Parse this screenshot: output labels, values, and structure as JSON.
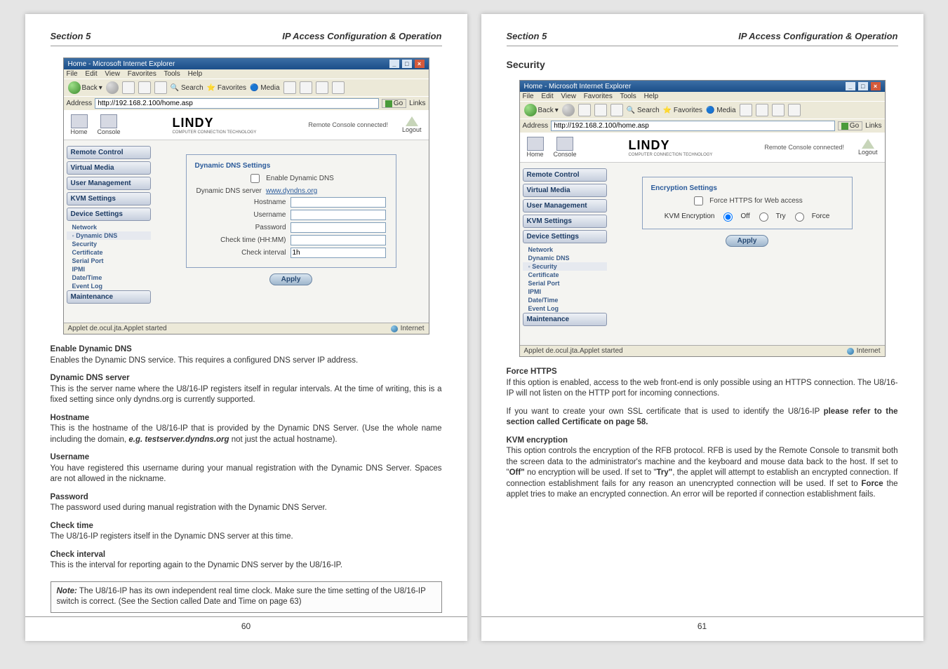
{
  "left": {
    "header": {
      "section": "Section 5",
      "title": "IP Access Configuration & Operation"
    },
    "pageNumber": "60",
    "ie": {
      "title": "Home - Microsoft Internet Explorer",
      "menus": [
        "File",
        "Edit",
        "View",
        "Favorites",
        "Tools",
        "Help"
      ],
      "toolbar": {
        "back": "Back",
        "search": "Search",
        "favorites": "Favorites",
        "media": "Media"
      },
      "address": {
        "label": "Address",
        "value": "http://192.168.2.100/home.asp",
        "go": "Go",
        "links": "Links"
      },
      "status": {
        "left": "Applet de.ocul.jta.Applet started",
        "right": "Internet"
      }
    },
    "app": {
      "top": {
        "home": "Home",
        "console": "Console",
        "logo": "LINDY",
        "logoSub": "COMPUTER CONNECTION TECHNOLOGY",
        "status": "Remote Console connected!",
        "logout": "Logout"
      },
      "sidebar": {
        "items": [
          "Remote Control",
          "Virtual Media",
          "User Management",
          "KVM Settings",
          "Device Settings"
        ],
        "subs": [
          "Network",
          "Dynamic DNS",
          "Security",
          "Certificate",
          "Serial Port",
          "IPMI",
          "Date/Time",
          "Event Log"
        ],
        "activeSub": "Dynamic DNS",
        "last": "Maintenance"
      },
      "form": {
        "legend": "Dynamic DNS Settings",
        "enable": "Enable Dynamic DNS",
        "serverLabel": "Dynamic DNS server",
        "serverValue": "www.dyndns.org",
        "hostname": "Hostname",
        "username": "Username",
        "password": "Password",
        "checkTime": "Check time (HH:MM)",
        "checkInterval": "Check interval",
        "intervalValue": "1h",
        "apply": "Apply"
      }
    },
    "body": {
      "t1": "Enable Dynamic DNS",
      "p1": "Enables the Dynamic DNS service. This requires a configured DNS server IP address.",
      "t2": "Dynamic DNS server",
      "p2": "This is the server name where the U8/16-IP registers itself in regular intervals. At the time of writing, this is a fixed setting since only dyndns.org is currently supported.",
      "t3": "Hostname",
      "p3a": "This is the hostname of the U8/16-IP that is provided by the Dynamic DNS Server. (Use the whole name including the domain, ",
      "p3b": "e.g. testserver.dyndns.org",
      "p3c": " not just the actual hostname).",
      "t4": "Username",
      "p4": "You have registered this username during your manual registration with the Dynamic DNS Server. Spaces are not allowed in the nickname.",
      "t5": "Password",
      "p5": "The password used during manual registration with the Dynamic DNS Server.",
      "t6": "Check time",
      "p6": "The U8/16-IP registers itself in the Dynamic DNS server at this time.",
      "t7": "Check interval",
      "p7": "This is the interval for reporting again to the Dynamic DNS server by the U8/16-IP.",
      "note": {
        "label": "Note:",
        "a": " The U8/16-IP has its own independent real time clock. Make sure the time setting of the U8/16-IP switch is correct. ",
        "b": "(See the Section called Date and Time on page 63)"
      }
    }
  },
  "right": {
    "header": {
      "section": "Section 5",
      "title": "IP Access Configuration & Operation"
    },
    "pageNumber": "61",
    "section": "Security",
    "ie": {
      "title": "Home - Microsoft Internet Explorer",
      "menus": [
        "File",
        "Edit",
        "View",
        "Favorites",
        "Tools",
        "Help"
      ],
      "toolbar": {
        "back": "Back",
        "search": "Search",
        "favorites": "Favorites",
        "media": "Media"
      },
      "address": {
        "label": "Address",
        "value": "http://192.168.2.100/home.asp",
        "go": "Go",
        "links": "Links"
      },
      "status": {
        "left": "Applet de.ocul.jta.Applet started",
        "right": "Internet"
      }
    },
    "app": {
      "top": {
        "home": "Home",
        "console": "Console",
        "logo": "LINDY",
        "logoSub": "COMPUTER CONNECTION TECHNOLOGY",
        "status": "Remote Console connected!",
        "logout": "Logout"
      },
      "sidebar": {
        "items": [
          "Remote Control",
          "Virtual Media",
          "User Management",
          "KVM Settings",
          "Device Settings"
        ],
        "subs": [
          "Network",
          "Dynamic DNS",
          "Security",
          "Certificate",
          "Serial Port",
          "IPMI",
          "Date/Time",
          "Event Log"
        ],
        "activeSub": "Security",
        "last": "Maintenance"
      },
      "form": {
        "legend": "Encryption Settings",
        "forceHttps": "Force HTTPS for Web access",
        "kvmEnc": "KVM Encryption",
        "off": "Off",
        "try": "Try",
        "force": "Force",
        "apply": "Apply"
      }
    },
    "body": {
      "t1": "Force HTTPS",
      "p1": "If this option is enabled, access to the web front-end is only possible using an HTTPS connection. The U8/16-IP will not listen on the HTTP port for incoming connections.",
      "p2a": "If you want to create your own SSL certificate that is used to identify the U8/16-IP ",
      "p2b": "please refer to the section called Certificate on page 58.",
      "t2": "KVM encryption",
      "p3a": "This option controls the encryption of the RFB protocol. RFB is used by the Remote Console to transmit both the screen data to the administrator's machine and the keyboard and mouse data back to the host. If set to \"",
      "p3b": "Off\"",
      "p3c": " no encryption will be used. If set to \"",
      "p3d": "Try\"",
      "p3e": ", the applet will attempt to establish an encrypted connection. If connection establishment fails for any reason an unencrypted connection will be used. If set to ",
      "p3f": "Force",
      "p3g": " the applet tries to make an encrypted connection. An error will be reported if connection establishment fails."
    }
  }
}
